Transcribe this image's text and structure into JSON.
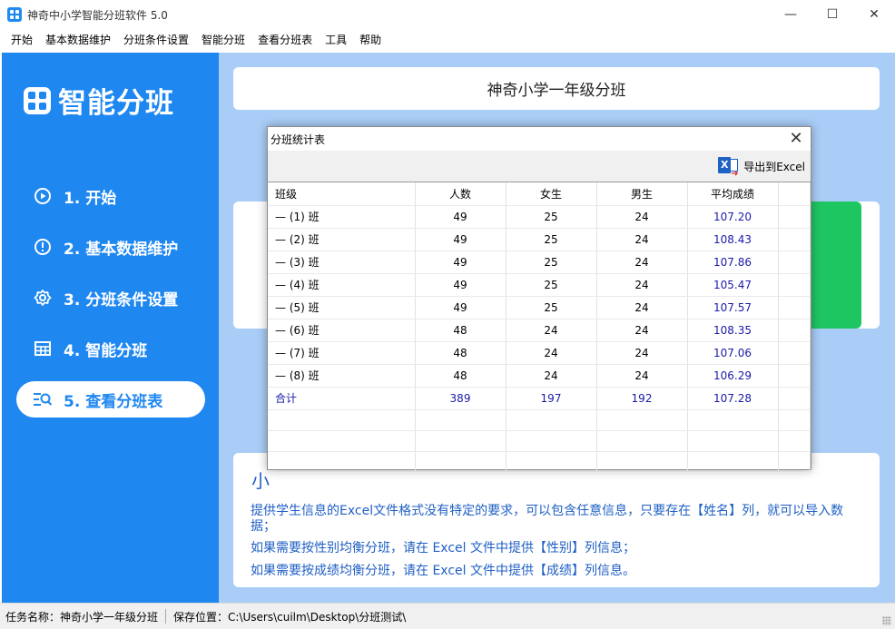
{
  "window": {
    "title": "神奇中小学智能分班软件 5.0",
    "controls": {
      "minimize": "—",
      "maximize": "☐",
      "close": "✕"
    }
  },
  "menu": [
    "开始",
    "基本数据维护",
    "分班条件设置",
    "智能分班",
    "查看分班表",
    "工具",
    "帮助"
  ],
  "sidebar": {
    "brand": "智能分班",
    "items": [
      {
        "label": "1. 开始",
        "icon": "play-circle-icon",
        "active": false
      },
      {
        "label": "2. 基本数据维护",
        "icon": "info-circle-icon",
        "active": false
      },
      {
        "label": "3. 分班条件设置",
        "icon": "gear-icon",
        "active": false
      },
      {
        "label": "4. 智能分班",
        "icon": "table-icon",
        "active": false
      },
      {
        "label": "5. 查看分班表",
        "icon": "search-list-icon",
        "active": true
      }
    ]
  },
  "main": {
    "header": "神奇小学一年级分班",
    "tips": {
      "title": "小",
      "lines": [
        "提供学生信息的Excel文件格式没有特定的要求，可以包含任意信息，只要存在【姓名】列，就可以导入数据；",
        "如果需要按性别均衡分班，请在 Excel 文件中提供【性别】列信息；",
        "如果需要按成绩均衡分班，请在 Excel 文件中提供【成绩】列信息。"
      ]
    }
  },
  "dialog": {
    "title": "分班统计表",
    "close": "✕",
    "export_label": "导出到Excel",
    "columns": [
      "班级",
      "人数",
      "女生",
      "男生",
      "平均成绩",
      ""
    ],
    "rows": [
      [
        "— (1) 班",
        "49",
        "25",
        "24",
        "107.20"
      ],
      [
        "— (2) 班",
        "49",
        "25",
        "24",
        "108.43"
      ],
      [
        "— (3) 班",
        "49",
        "25",
        "24",
        "107.86"
      ],
      [
        "— (4) 班",
        "49",
        "25",
        "24",
        "105.47"
      ],
      [
        "— (5) 班",
        "49",
        "25",
        "24",
        "107.57"
      ],
      [
        "— (6) 班",
        "48",
        "24",
        "24",
        "108.35"
      ],
      [
        "— (7) 班",
        "48",
        "24",
        "24",
        "107.06"
      ],
      [
        "— (8) 班",
        "48",
        "24",
        "24",
        "106.29"
      ]
    ],
    "total": [
      "合计",
      "389",
      "197",
      "192",
      "107.28"
    ]
  },
  "status": {
    "task": "任务名称：神奇小学一年级分班",
    "path": "保存位置：C:\\Users\\cuilm\\Desktop\\分班测试\\"
  },
  "colors": {
    "sidebar": "#1f87f0",
    "main_bg": "#a9cdf6",
    "accent_green": "#1ec662",
    "tip_text": "#1f5fc4",
    "value_blue": "#1a1aa8"
  }
}
